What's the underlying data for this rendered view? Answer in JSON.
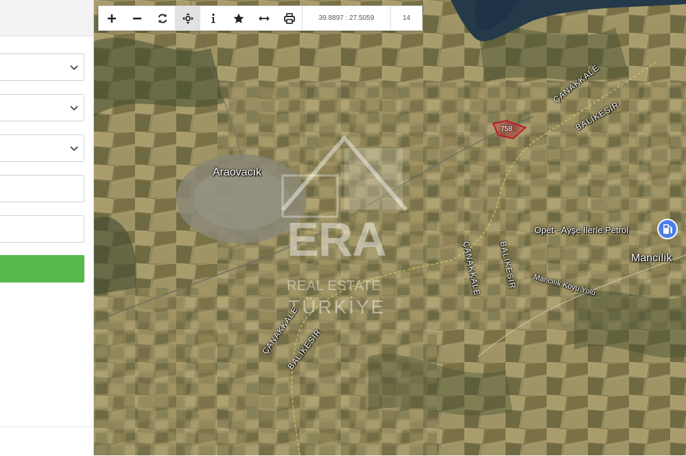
{
  "toolbar": {
    "buttons": [
      {
        "name": "zoom-in",
        "icon": "plus-icon"
      },
      {
        "name": "zoom-out",
        "icon": "minus-icon"
      },
      {
        "name": "refresh",
        "icon": "refresh-icon"
      },
      {
        "name": "pan",
        "icon": "move-icon",
        "active": true
      },
      {
        "name": "info",
        "icon": "info-icon"
      },
      {
        "name": "favorite",
        "icon": "star-icon"
      },
      {
        "name": "measure",
        "icon": "arrows-horizontal-icon"
      },
      {
        "name": "print",
        "icon": "printer-icon"
      }
    ],
    "coordinates": "39.8897 : 27.5059",
    "zoom_level": "14"
  },
  "form": {
    "selects": [
      "",
      "",
      ""
    ],
    "inputs": [
      "",
      ""
    ],
    "submit_label": "",
    "accent_color": "#56b94c"
  },
  "map": {
    "parcel_label": "758",
    "places": {
      "town_1": "Araovacık",
      "town_2": "Mancılık",
      "poi": "Opet - Ayşe İlerle Petrol",
      "road_village": "Mancılık Köyü Yolu"
    },
    "boundaries": {
      "canakkale_1": "ÇANAKKALE",
      "balikesir_1": "BALIKESIR",
      "canakkale_2": "ÇANAKKALE",
      "balikesir_2": "BALIKESİR",
      "canakkale_3": "ÇANAKKALE",
      "balikesir_3": "BALIKESİR"
    },
    "watermark": {
      "brand": "ERA",
      "line1": "REAL ESTATE",
      "line2": "TÜRKİYE"
    },
    "colors": {
      "parcel_outline": "#c0182e",
      "poi_icon": "#4a7ee8"
    }
  }
}
